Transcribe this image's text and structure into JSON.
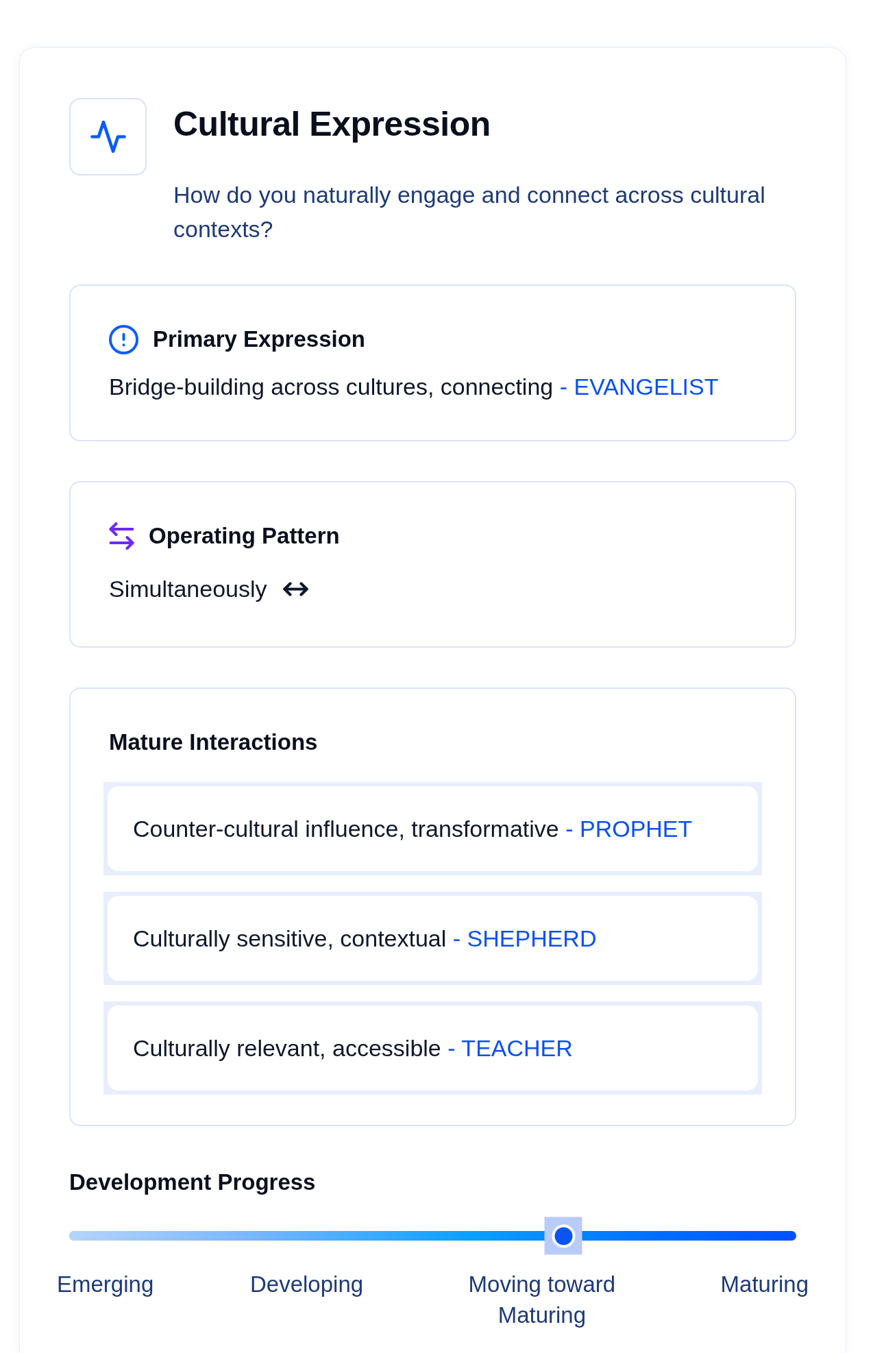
{
  "header": {
    "title": "Cultural Expression",
    "question": "How do you naturally engage and connect across cultural contexts?"
  },
  "primary_expression": {
    "title": "Primary Expression",
    "text": "Bridge-building across cultures, connecting",
    "role": "- EVANGELIST"
  },
  "operating_pattern": {
    "title": "Operating Pattern",
    "value": "Simultaneously"
  },
  "mature_interactions": {
    "title": "Mature Interactions",
    "items": [
      {
        "text": "Counter-cultural influence, transformative",
        "role": "- PROPHET"
      },
      {
        "text": "Culturally sensitive, contextual",
        "role": "- SHEPHERD"
      },
      {
        "text": "Culturally relevant, accessible",
        "role": "- TEACHER"
      }
    ]
  },
  "development_progress": {
    "title": "Development Progress",
    "level": 0.68,
    "stages": [
      "Emerging",
      "Developing",
      "Moving toward Maturing",
      "Maturing"
    ]
  }
}
